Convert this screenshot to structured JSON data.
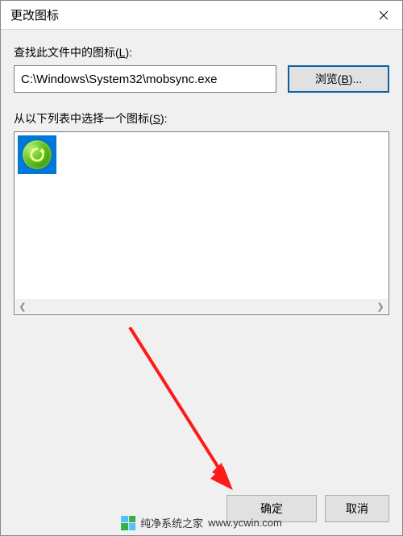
{
  "window": {
    "title": "更改图标"
  },
  "labels": {
    "lookup": "查找此文件中的图标(",
    "lookup_key": "L",
    "lookup_suffix": "):",
    "select": "从以下列表中选择一个图标(",
    "select_key": "S",
    "select_suffix": "):"
  },
  "path": {
    "value": "C:\\Windows\\System32\\mobsync.exe"
  },
  "buttons": {
    "browse": "浏览(",
    "browse_key": "B",
    "browse_suffix": ")...",
    "ok": "确定",
    "cancel": "取消"
  },
  "icons": {
    "selected": "sync-icon"
  },
  "watermark": {
    "site": "纯净系统之家",
    "url": "www.ycwin.com"
  }
}
